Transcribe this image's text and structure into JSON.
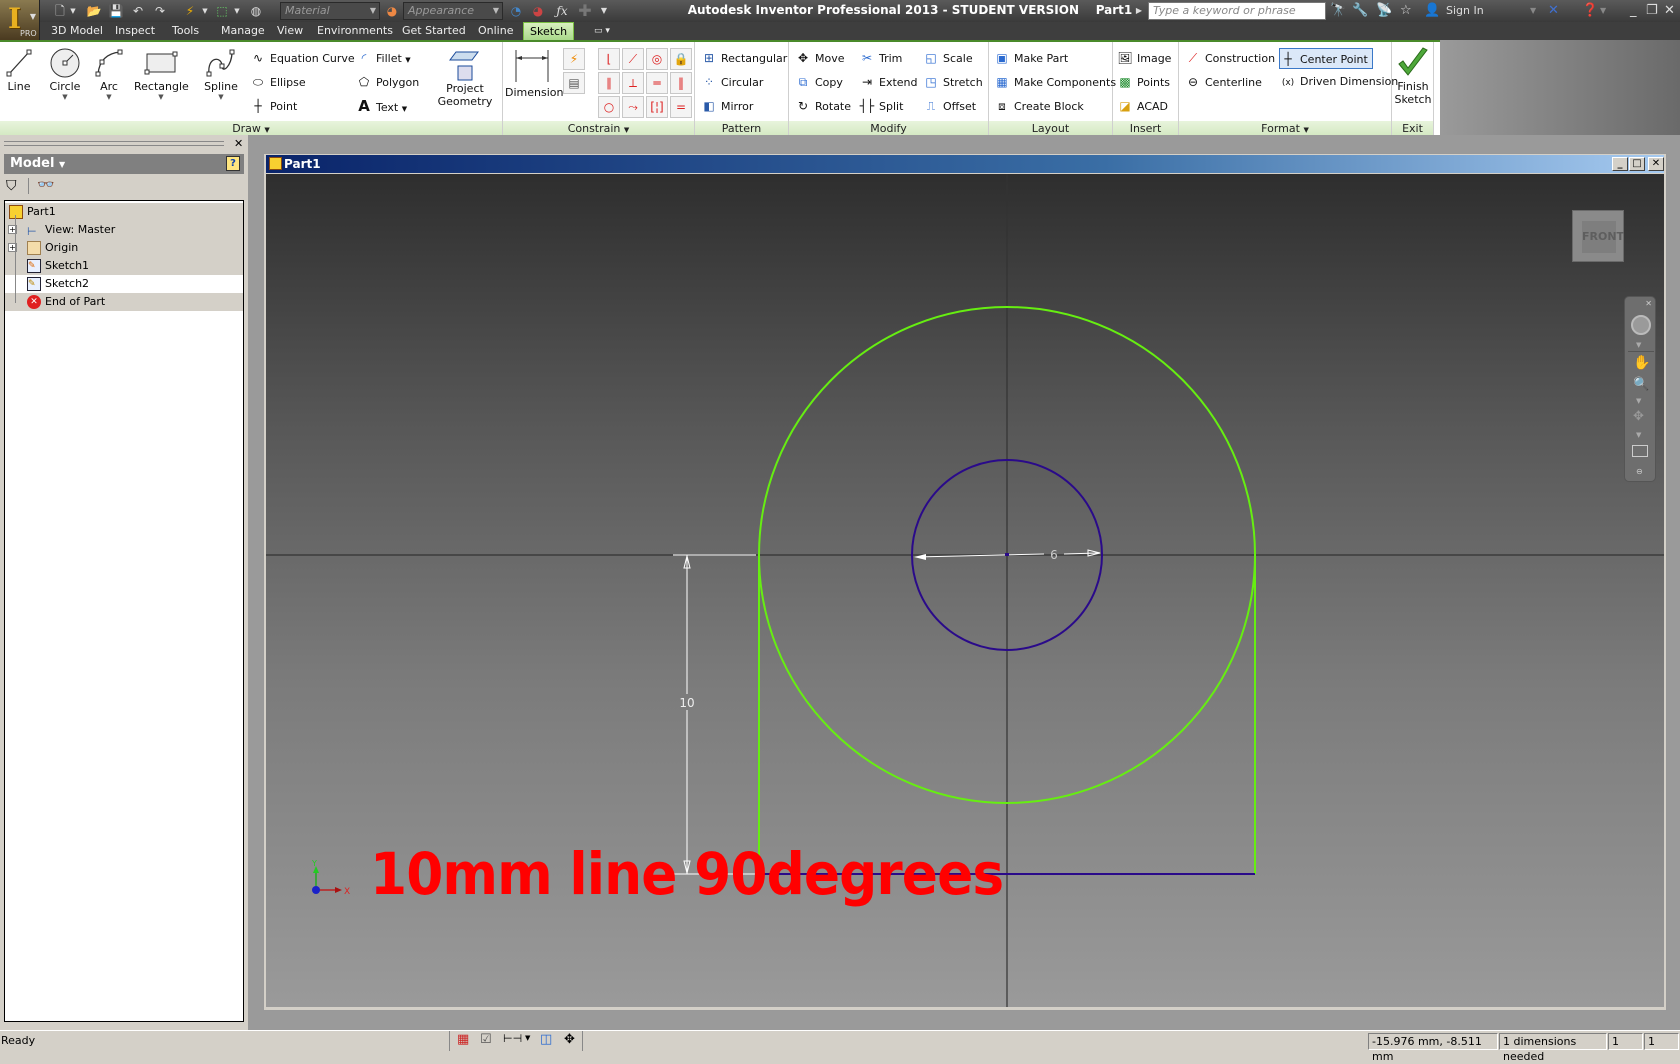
{
  "app": {
    "title": "Autodesk Inventor Professional 2013 - STUDENT VERSION    Part1",
    "edition_badge": "PRO"
  },
  "quick_access": {
    "material_placeholder": "Material",
    "appearance_placeholder": "Appearance"
  },
  "infocenter": {
    "search_placeholder": "Type a keyword or phrase",
    "sign_in": "Sign In"
  },
  "menu_tabs": [
    {
      "label": "3D Model"
    },
    {
      "label": "Inspect"
    },
    {
      "label": "Tools"
    },
    {
      "label": "Manage"
    },
    {
      "label": "View"
    },
    {
      "label": "Environments"
    },
    {
      "label": "Get Started"
    },
    {
      "label": "Online"
    },
    {
      "label": "Sketch",
      "active": true
    }
  ],
  "ribbon": {
    "draw": {
      "label": "Draw",
      "big": [
        "Line",
        "Circle",
        "Arc",
        "Rectangle",
        "Spline"
      ],
      "small": [
        "Equation Curve",
        "Ellipse",
        "Point",
        "Fillet",
        "Polygon",
        "Text"
      ]
    },
    "project_geometry": {
      "line1": "Project",
      "line2": "Geometry"
    },
    "constrain": {
      "label": "Constrain",
      "dimension": "Dimension"
    },
    "pattern": {
      "label": "Pattern",
      "items": [
        "Rectangular",
        "Circular",
        "Mirror"
      ]
    },
    "modify": {
      "label": "Modify",
      "items": [
        "Move",
        "Copy",
        "Rotate",
        "Trim",
        "Extend",
        "Split",
        "Scale",
        "Stretch",
        "Offset"
      ]
    },
    "layout": {
      "label": "Layout",
      "items": [
        "Make Part",
        "Make Components",
        "Create Block"
      ]
    },
    "insert": {
      "label": "Insert",
      "items": [
        "Image",
        "Points",
        "ACAD"
      ]
    },
    "format": {
      "label": "Format",
      "items": [
        "Construction",
        "Centerline",
        "Center Point",
        "Driven Dimension"
      ],
      "active": "Center Point"
    },
    "exit": {
      "label": "Exit",
      "finish_line1": "Finish",
      "finish_line2": "Sketch"
    }
  },
  "browser": {
    "header": "Model",
    "tree": [
      {
        "label": "Part1",
        "icon": "part-icon"
      },
      {
        "label": "View: Master",
        "icon": "view-icon",
        "expandable": true
      },
      {
        "label": "Origin",
        "icon": "folder-icon",
        "expandable": true
      },
      {
        "label": "Sketch1",
        "icon": "sketch-icon"
      },
      {
        "label": "Sketch2",
        "icon": "sketch-icon",
        "selected": true
      },
      {
        "label": "End of Part",
        "icon": "end-of-part-icon"
      }
    ]
  },
  "document": {
    "title": "Part1",
    "viewcube_face": "FRONT",
    "dimensions": {
      "horizontal": "6",
      "vertical": "10"
    },
    "annotation": "10mm line 90degrees",
    "axis_labels": {
      "x": "X",
      "y": "Y"
    },
    "colors": {
      "outer_circle": "#66ee11",
      "inner_circle": "#2a0a8a",
      "bottom_line": "#2a0a8a",
      "annotation": "#ff0000"
    }
  },
  "status": {
    "text": "Ready",
    "coordinates": "-15.976 mm, -8.511 mm",
    "dimensions_needed": "1 dimensions needed",
    "field1": "1",
    "field2": "1"
  }
}
